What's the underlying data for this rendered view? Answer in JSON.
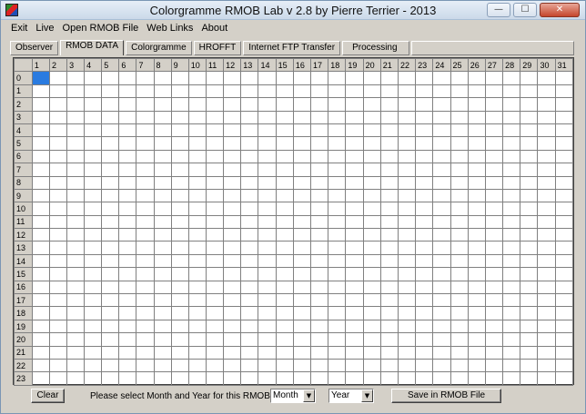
{
  "window": {
    "title": "Colorgramme RMOB Lab v 2.8  by Pierre Terrier  -  2013",
    "minimize_glyph": "—",
    "maximize_glyph": "☐",
    "close_glyph": "✕"
  },
  "menu": [
    "Exit",
    "Live",
    "Open RMOB File",
    "Web Links",
    "About"
  ],
  "tabs": [
    {
      "label": "Observer",
      "active": false
    },
    {
      "label": "RMOB DATA",
      "active": true
    },
    {
      "label": "Colorgramme",
      "active": false
    },
    {
      "label": "HROFFT",
      "active": false
    },
    {
      "label": "Internet FTP Transfer",
      "active": false
    },
    {
      "label": "Processing",
      "active": false
    }
  ],
  "grid": {
    "column_headers": [
      "1",
      "2",
      "3",
      "4",
      "5",
      "6",
      "7",
      "8",
      "9",
      "10",
      "11",
      "12",
      "13",
      "14",
      "15",
      "16",
      "17",
      "18",
      "19",
      "20",
      "21",
      "22",
      "23",
      "24",
      "25",
      "26",
      "27",
      "28",
      "29",
      "30",
      "31"
    ],
    "row_headers": [
      "0",
      "1",
      "2",
      "3",
      "4",
      "5",
      "6",
      "7",
      "8",
      "9",
      "10",
      "11",
      "12",
      "13",
      "14",
      "15",
      "16",
      "17",
      "18",
      "19",
      "20",
      "21",
      "22",
      "23"
    ],
    "selection_color": "#2a7be0"
  },
  "bottom": {
    "clear_label": "Clear",
    "prompt": "Please select Month and Year for this RMOB file",
    "month_value": "Month",
    "year_value": "Year",
    "save_label": "Save in RMOB File"
  }
}
